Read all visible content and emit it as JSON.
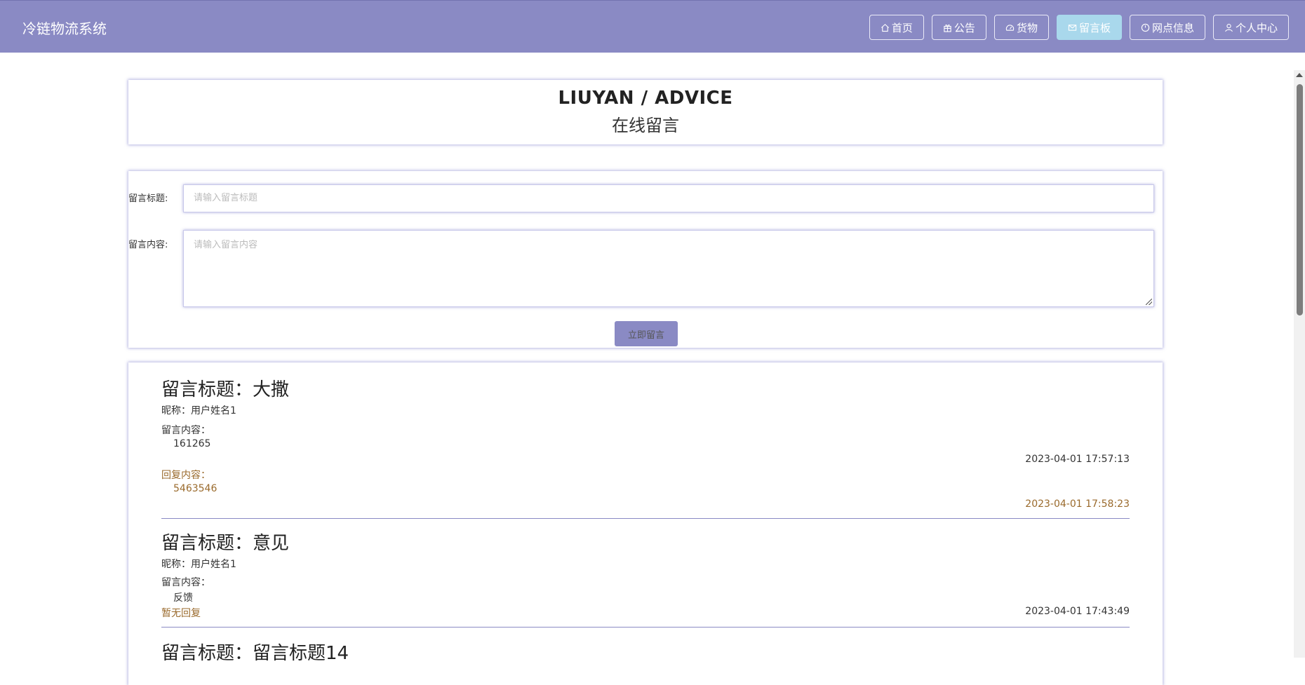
{
  "app": {
    "brand": "冷链物流系统"
  },
  "nav": [
    {
      "label": "首页",
      "icon": "home-icon",
      "active": false
    },
    {
      "label": "公告",
      "icon": "gift-icon",
      "active": false
    },
    {
      "label": "货物",
      "icon": "dashboard-icon",
      "active": false
    },
    {
      "label": "留言板",
      "icon": "mail-icon",
      "active": true
    },
    {
      "label": "网点信息",
      "icon": "clock-icon",
      "active": false
    },
    {
      "label": "个人中心",
      "icon": "user-icon",
      "active": false
    }
  ],
  "header": {
    "title_en": "LIUYAN / ADVICE",
    "title_cn": "在线留言"
  },
  "form": {
    "title_label": "留言标题:",
    "title_placeholder": "请输入留言标题",
    "content_label": "留言内容:",
    "content_placeholder": "请输入留言内容",
    "submit_label": "立即留言"
  },
  "messages": [
    {
      "title": "留言标题：大撒",
      "nickname": "昵称：用户姓名1",
      "content_label": "留言内容：",
      "content": "161265",
      "time": "2023-04-01 17:57:13",
      "reply_label": "回复内容：",
      "reply": "5463546",
      "reply_time": "2023-04-01 17:58:23"
    },
    {
      "title": "留言标题：意见",
      "nickname": "昵称：用户姓名1",
      "content_label": "留言内容：",
      "content": "反馈",
      "no_reply": "暂无回复",
      "time": "2023-04-01 17:43:49"
    },
    {
      "title": "留言标题：留言标题14"
    }
  ]
}
